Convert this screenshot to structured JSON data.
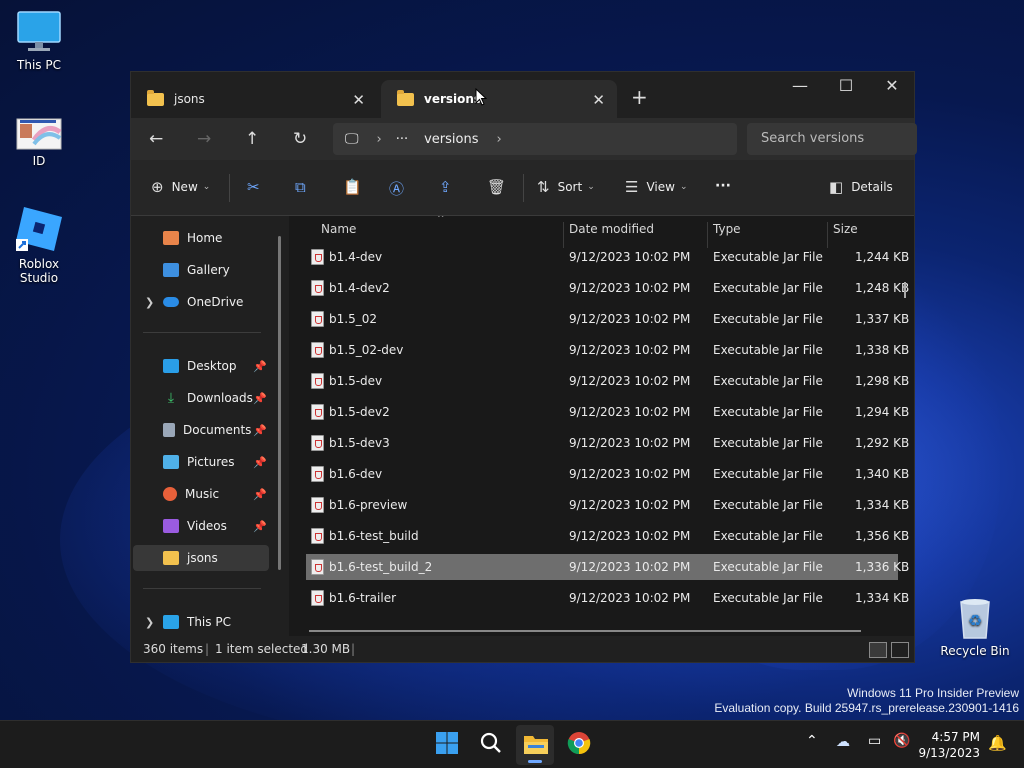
{
  "desktop": {
    "icons": [
      {
        "label": "This PC"
      },
      {
        "label": "ID"
      },
      {
        "label": "Roblox Studio"
      },
      {
        "label": "Recycle Bin"
      }
    ],
    "watermark_line1": "Windows 11 Pro Insider Preview",
    "watermark_line2": "Evaluation copy. Build 25947.rs_prerelease.230901-1416"
  },
  "window": {
    "tabs": [
      {
        "label": "jsons"
      },
      {
        "label": "versions"
      }
    ],
    "address": {
      "ellipsis": "···",
      "folder": "versions"
    },
    "search_placeholder": "Search versions",
    "toolbar": {
      "new_label": "New",
      "sort_label": "Sort",
      "view_label": "View",
      "more_label": "···",
      "details_label": "Details"
    },
    "nav": {
      "home": "Home",
      "gallery": "Gallery",
      "onedrive": "OneDrive",
      "desktop": "Desktop",
      "downloads": "Downloads",
      "documents": "Documents",
      "pictures": "Pictures",
      "music": "Music",
      "videos": "Videos",
      "jsons": "jsons",
      "thispc": "This PC"
    },
    "columns": {
      "name": "Name",
      "date": "Date modified",
      "type": "Type",
      "size": "Size"
    },
    "files": [
      {
        "name": "b1.4-dev",
        "date": "9/12/2023 10:02 PM",
        "type": "Executable Jar File",
        "size": "1,244 KB"
      },
      {
        "name": "b1.4-dev2",
        "date": "9/12/2023 10:02 PM",
        "type": "Executable Jar File",
        "size": "1,248 KB"
      },
      {
        "name": "b1.5_02",
        "date": "9/12/2023 10:02 PM",
        "type": "Executable Jar File",
        "size": "1,337 KB"
      },
      {
        "name": "b1.5_02-dev",
        "date": "9/12/2023 10:02 PM",
        "type": "Executable Jar File",
        "size": "1,338 KB"
      },
      {
        "name": "b1.5-dev",
        "date": "9/12/2023 10:02 PM",
        "type": "Executable Jar File",
        "size": "1,298 KB"
      },
      {
        "name": "b1.5-dev2",
        "date": "9/12/2023 10:02 PM",
        "type": "Executable Jar File",
        "size": "1,294 KB"
      },
      {
        "name": "b1.5-dev3",
        "date": "9/12/2023 10:02 PM",
        "type": "Executable Jar File",
        "size": "1,292 KB"
      },
      {
        "name": "b1.6-dev",
        "date": "9/12/2023 10:02 PM",
        "type": "Executable Jar File",
        "size": "1,340 KB"
      },
      {
        "name": "b1.6-preview",
        "date": "9/12/2023 10:02 PM",
        "type": "Executable Jar File",
        "size": "1,334 KB"
      },
      {
        "name": "b1.6-test_build",
        "date": "9/12/2023 10:02 PM",
        "type": "Executable Jar File",
        "size": "1,356 KB"
      },
      {
        "name": "b1.6-test_build_2",
        "date": "9/12/2023 10:02 PM",
        "type": "Executable Jar File",
        "size": "1,336 KB"
      },
      {
        "name": "b1.6-trailer",
        "date": "9/12/2023 10:02 PM",
        "type": "Executable Jar File",
        "size": "1,334 KB"
      }
    ],
    "status": {
      "count": "360 items",
      "selected": "1 item selected",
      "size": "1.30 MB"
    }
  },
  "taskbar": {
    "time": "4:57 PM",
    "date": "9/13/2023"
  },
  "colors": {
    "accent": "#6fa8ff",
    "folder": "#f2c14e",
    "selected_row": "#6e6e6e"
  }
}
